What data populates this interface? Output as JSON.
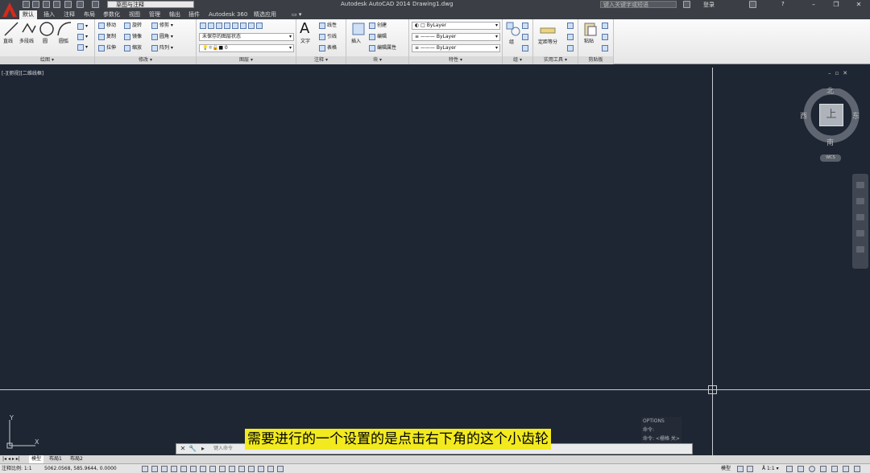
{
  "titlebar": {
    "workspace": "草图与注释",
    "app_title": "Autodesk AutoCAD 2014",
    "document": "Drawing1.dwg",
    "search_placeholder": "键入关键字或短语",
    "login": "登录",
    "help": "?"
  },
  "tabs": [
    "默认",
    "插入",
    "注释",
    "布局",
    "参数化",
    "视图",
    "管理",
    "输出",
    "插件",
    "Autodesk 360",
    "精选应用"
  ],
  "ribbon": {
    "draw": {
      "title": "绘图",
      "line": "直线",
      "polyline": "多段线",
      "circle": "圆",
      "arc": "圆弧"
    },
    "modify": {
      "title": "修改",
      "move": "移动",
      "rotate": "旋转",
      "trim": "修剪",
      "copy": "复制",
      "mirror": "镜像",
      "fillet": "圆角",
      "stretch": "拉伸",
      "scale": "缩放",
      "array": "阵列"
    },
    "layers": {
      "title": "图层",
      "state": "未保存的图层状态",
      "current": "0"
    },
    "annotation": {
      "title": "注释",
      "text": "文字",
      "linear": "线性",
      "leader": "引线",
      "table": "表格"
    },
    "block": {
      "title": "块",
      "insert": "插入",
      "create": "创建",
      "edit": "编辑",
      "edit_attributes": "编辑属性"
    },
    "properties": {
      "title": "特性",
      "color": "ByLayer",
      "linetype": "ByLayer",
      "lineweight": "ByLayer"
    },
    "groups": {
      "title": "组",
      "group": "组"
    },
    "utilities": {
      "title": "实用工具",
      "measure": "定距等分"
    },
    "clipboard": {
      "title": "剪贴板",
      "paste": "粘贴"
    }
  },
  "viewport": {
    "label": "[-][俯视][二维线框]"
  },
  "viewcube": {
    "north": "北",
    "south": "南",
    "east": "东",
    "west": "西",
    "top": "上",
    "wcs": "WCS"
  },
  "ucs": {
    "x": "X",
    "y": "Y"
  },
  "command": {
    "history": [
      "OPTIONS",
      "命令:",
      "命令: <栅格 关>"
    ],
    "placeholder": "键入命令"
  },
  "subtitle": "需要进行的一个设置的是点击右下角的这个小齿轮",
  "layout_tabs": [
    "模型",
    "布局1",
    "布局2"
  ],
  "statusbar": {
    "scale_label": "注释比例: 1:1",
    "coordinates": "5062.0568, 585.9644, 0.0000",
    "model": "模型",
    "annoscale": "1:1"
  },
  "colors": {
    "canvas": "#1e2633",
    "titlebar": "#3b3f45",
    "subtitle_bg": "#f2ea1e",
    "ribbon": "#f0f0f0"
  }
}
